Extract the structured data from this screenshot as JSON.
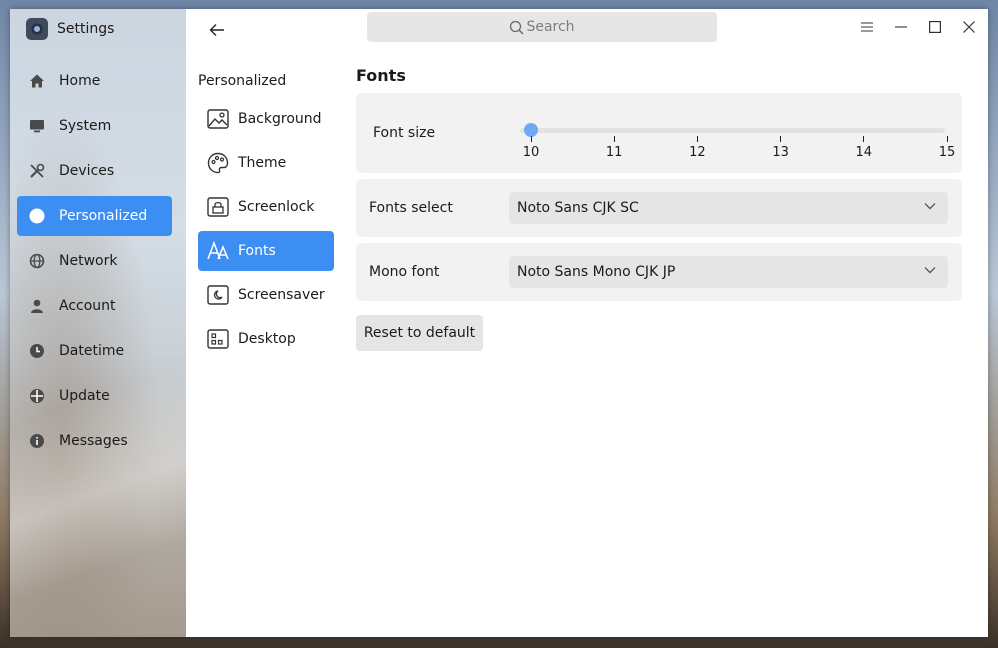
{
  "app": {
    "title": "Settings"
  },
  "search": {
    "placeholder": "Search"
  },
  "sidebar": {
    "items": [
      {
        "label": "Home",
        "icon": "home-icon"
      },
      {
        "label": "System",
        "icon": "monitor-icon"
      },
      {
        "label": "Devices",
        "icon": "tools-icon"
      },
      {
        "label": "Personalized",
        "icon": "palette-icon",
        "active": true
      },
      {
        "label": "Network",
        "icon": "globe-icon"
      },
      {
        "label": "Account",
        "icon": "user-icon"
      },
      {
        "label": "Datetime",
        "icon": "clock-icon"
      },
      {
        "label": "Update",
        "icon": "update-icon"
      },
      {
        "label": "Messages",
        "icon": "info-icon"
      }
    ]
  },
  "subnav": {
    "title": "Personalized",
    "items": [
      {
        "label": "Background",
        "icon": "image-icon"
      },
      {
        "label": "Theme",
        "icon": "palette-icon"
      },
      {
        "label": "Screenlock",
        "icon": "screenlock-icon"
      },
      {
        "label": "Fonts",
        "icon": "font-icon",
        "active": true
      },
      {
        "label": "Screensaver",
        "icon": "screensaver-icon"
      },
      {
        "label": "Desktop",
        "icon": "desktop-icon"
      }
    ]
  },
  "content": {
    "title": "Fonts",
    "font_size": {
      "label": "Font size",
      "ticks": [
        "10",
        "11",
        "12",
        "13",
        "14",
        "15"
      ],
      "value": 10
    },
    "fonts_select": {
      "label": "Fonts select",
      "value": "Noto Sans CJK SC"
    },
    "mono_font": {
      "label": "Mono font",
      "value": "Noto Sans Mono CJK JP"
    },
    "reset_label": "Reset to default"
  },
  "colors": {
    "accent": "#3d8ef3",
    "slider_handle": "#6fa9f4"
  }
}
